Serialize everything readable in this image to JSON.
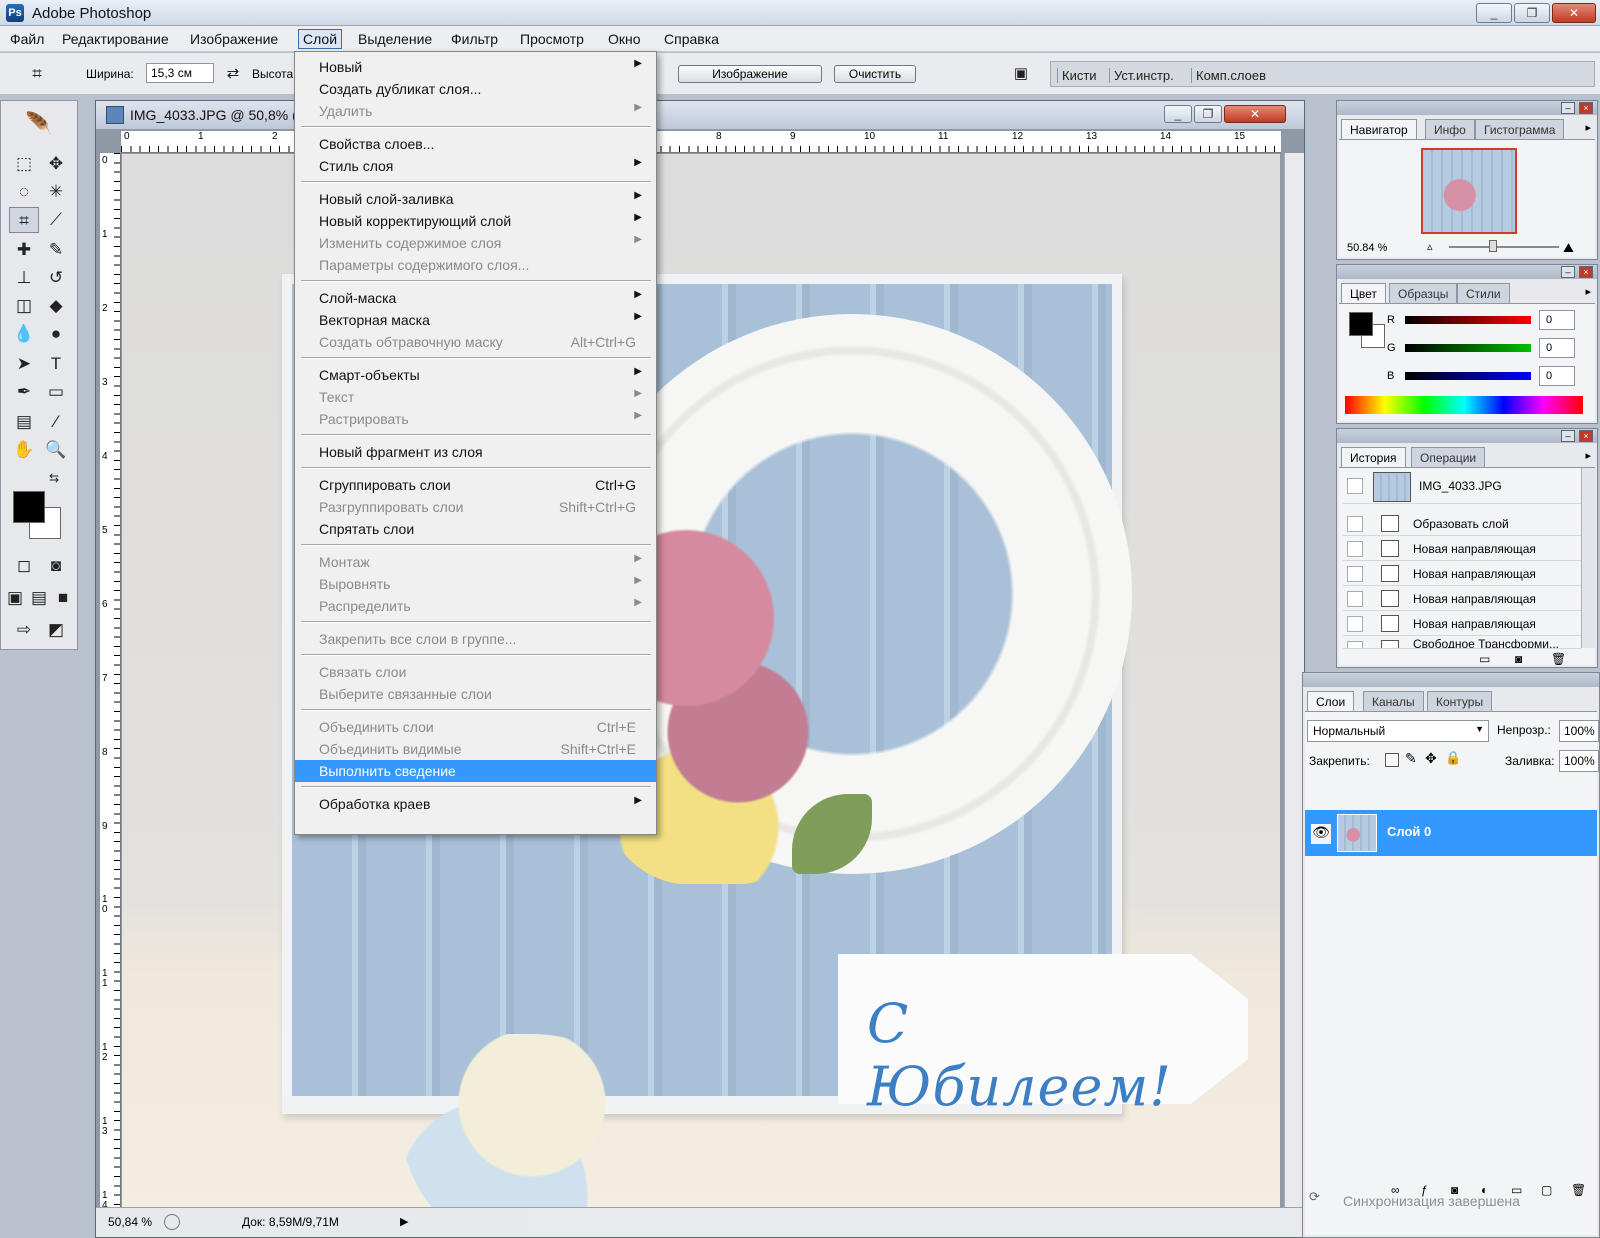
{
  "app": {
    "title": "Adobe Photoshop"
  },
  "menubar": {
    "items": [
      "Файл",
      "Редактирование",
      "Изображение",
      "Слой",
      "Выделение",
      "Фильтр",
      "Просмотр",
      "Окно",
      "Справка"
    ],
    "active": "Слой"
  },
  "options_bar": {
    "width_label": "Ширина:",
    "width_value": "15,3 см",
    "height_label": "Высота",
    "image_button": "Изображение",
    "clear_button": "Очистить",
    "well_tabs": [
      "Кисти",
      "Уст.инстр.",
      "Комп.слоев"
    ]
  },
  "document": {
    "title": "IMG_4033.JPG @ 50,8% (",
    "ruler_h": [
      "0",
      "1",
      "2",
      "8",
      "9",
      "10",
      "11",
      "12",
      "13",
      "14",
      "15"
    ],
    "ruler_v": [
      "0",
      "1",
      "2",
      "3",
      "4",
      "5",
      "6",
      "7",
      "8",
      "9",
      "1\n0",
      "1\n1",
      "1\n2",
      "1\n3",
      "1\n4"
    ],
    "status_zoom": "50,84 %",
    "status_doc": "Док: 8,59M/9,71M",
    "tag_text": "С Юбилеем!"
  },
  "layer_menu": {
    "items": [
      {
        "label": "Новый",
        "arrow": true
      },
      {
        "label": "Создать дубликат слоя...",
        "arrow": false
      },
      {
        "label": "Удалить",
        "arrow": true,
        "disabled": true
      },
      {
        "label": "Свойства слоев...",
        "arrow": false
      },
      {
        "label": "Стиль слоя",
        "arrow": true
      },
      {
        "label": "Новый слой-заливка",
        "arrow": true
      },
      {
        "label": "Новый корректирующий слой",
        "arrow": true
      },
      {
        "label": "Изменить содержимое слоя",
        "arrow": true,
        "disabled": true
      },
      {
        "label": "Параметры содержимого слоя...",
        "disabled": true
      },
      {
        "label": "Слой-маска",
        "arrow": true
      },
      {
        "label": "Векторная маска",
        "arrow": true
      },
      {
        "label": "Создать обтравочную маску",
        "shortcut": "Alt+Ctrl+G",
        "disabled": true
      },
      {
        "label": "Смарт-объекты",
        "arrow": true
      },
      {
        "label": "Текст",
        "arrow": true,
        "disabled": true
      },
      {
        "label": "Растрировать",
        "arrow": true,
        "disabled": true
      },
      {
        "label": "Новый фрагмент из слоя"
      },
      {
        "label": "Сгруппировать слои",
        "shortcut": "Ctrl+G"
      },
      {
        "label": "Разгруппировать слои",
        "shortcut": "Shift+Ctrl+G",
        "disabled": true
      },
      {
        "label": "Спрятать слои"
      },
      {
        "label": "Монтаж",
        "arrow": true,
        "disabled": true
      },
      {
        "label": "Выровнять",
        "arrow": true,
        "disabled": true
      },
      {
        "label": "Распределить",
        "arrow": true,
        "disabled": true
      },
      {
        "label": "Закрепить все слои в группе...",
        "disabled": true
      },
      {
        "label": "Связать слои",
        "disabled": true
      },
      {
        "label": "Выберите связанные слои",
        "disabled": true
      },
      {
        "label": "Объединить слои",
        "shortcut": "Ctrl+E",
        "disabled": true
      },
      {
        "label": "Объединить видимые",
        "shortcut": "Shift+Ctrl+E",
        "disabled": true
      },
      {
        "label": "Выполнить сведение",
        "highlighted": true
      },
      {
        "label": "Обработка краев",
        "arrow": true
      }
    ]
  },
  "navigator": {
    "tabs": [
      "Навигатор",
      "Инфо",
      "Гистограмма"
    ],
    "zoom": "50.84 %"
  },
  "color_panel": {
    "tabs": [
      "Цвет",
      "Образцы",
      "Стили"
    ],
    "channels": [
      {
        "name": "R",
        "value": "0",
        "color": "#ff0000"
      },
      {
        "name": "G",
        "value": "0",
        "color": "#00c000"
      },
      {
        "name": "B",
        "value": "0",
        "color": "#0000ff"
      }
    ]
  },
  "history_panel": {
    "tabs": [
      "История",
      "Операции"
    ],
    "snapshot": "IMG_4033.JPG",
    "steps": [
      "Образовать слой",
      "Новая направляющая",
      "Новая направляющая",
      "Новая направляющая",
      "Новая направляющая",
      "Свободное Трансформи..."
    ]
  },
  "layers_panel": {
    "tabs": [
      "Слои",
      "Каналы",
      "Контуры"
    ],
    "blend_mode": "Нормальный",
    "opacity_label": "Непрозр.:",
    "opacity_value": "100%",
    "lock_label": "Закрепить:",
    "fill_label": "Заливка:",
    "fill_value": "100%",
    "layer_name": "Слой 0"
  },
  "sync_status": "Синхронизация завершена"
}
